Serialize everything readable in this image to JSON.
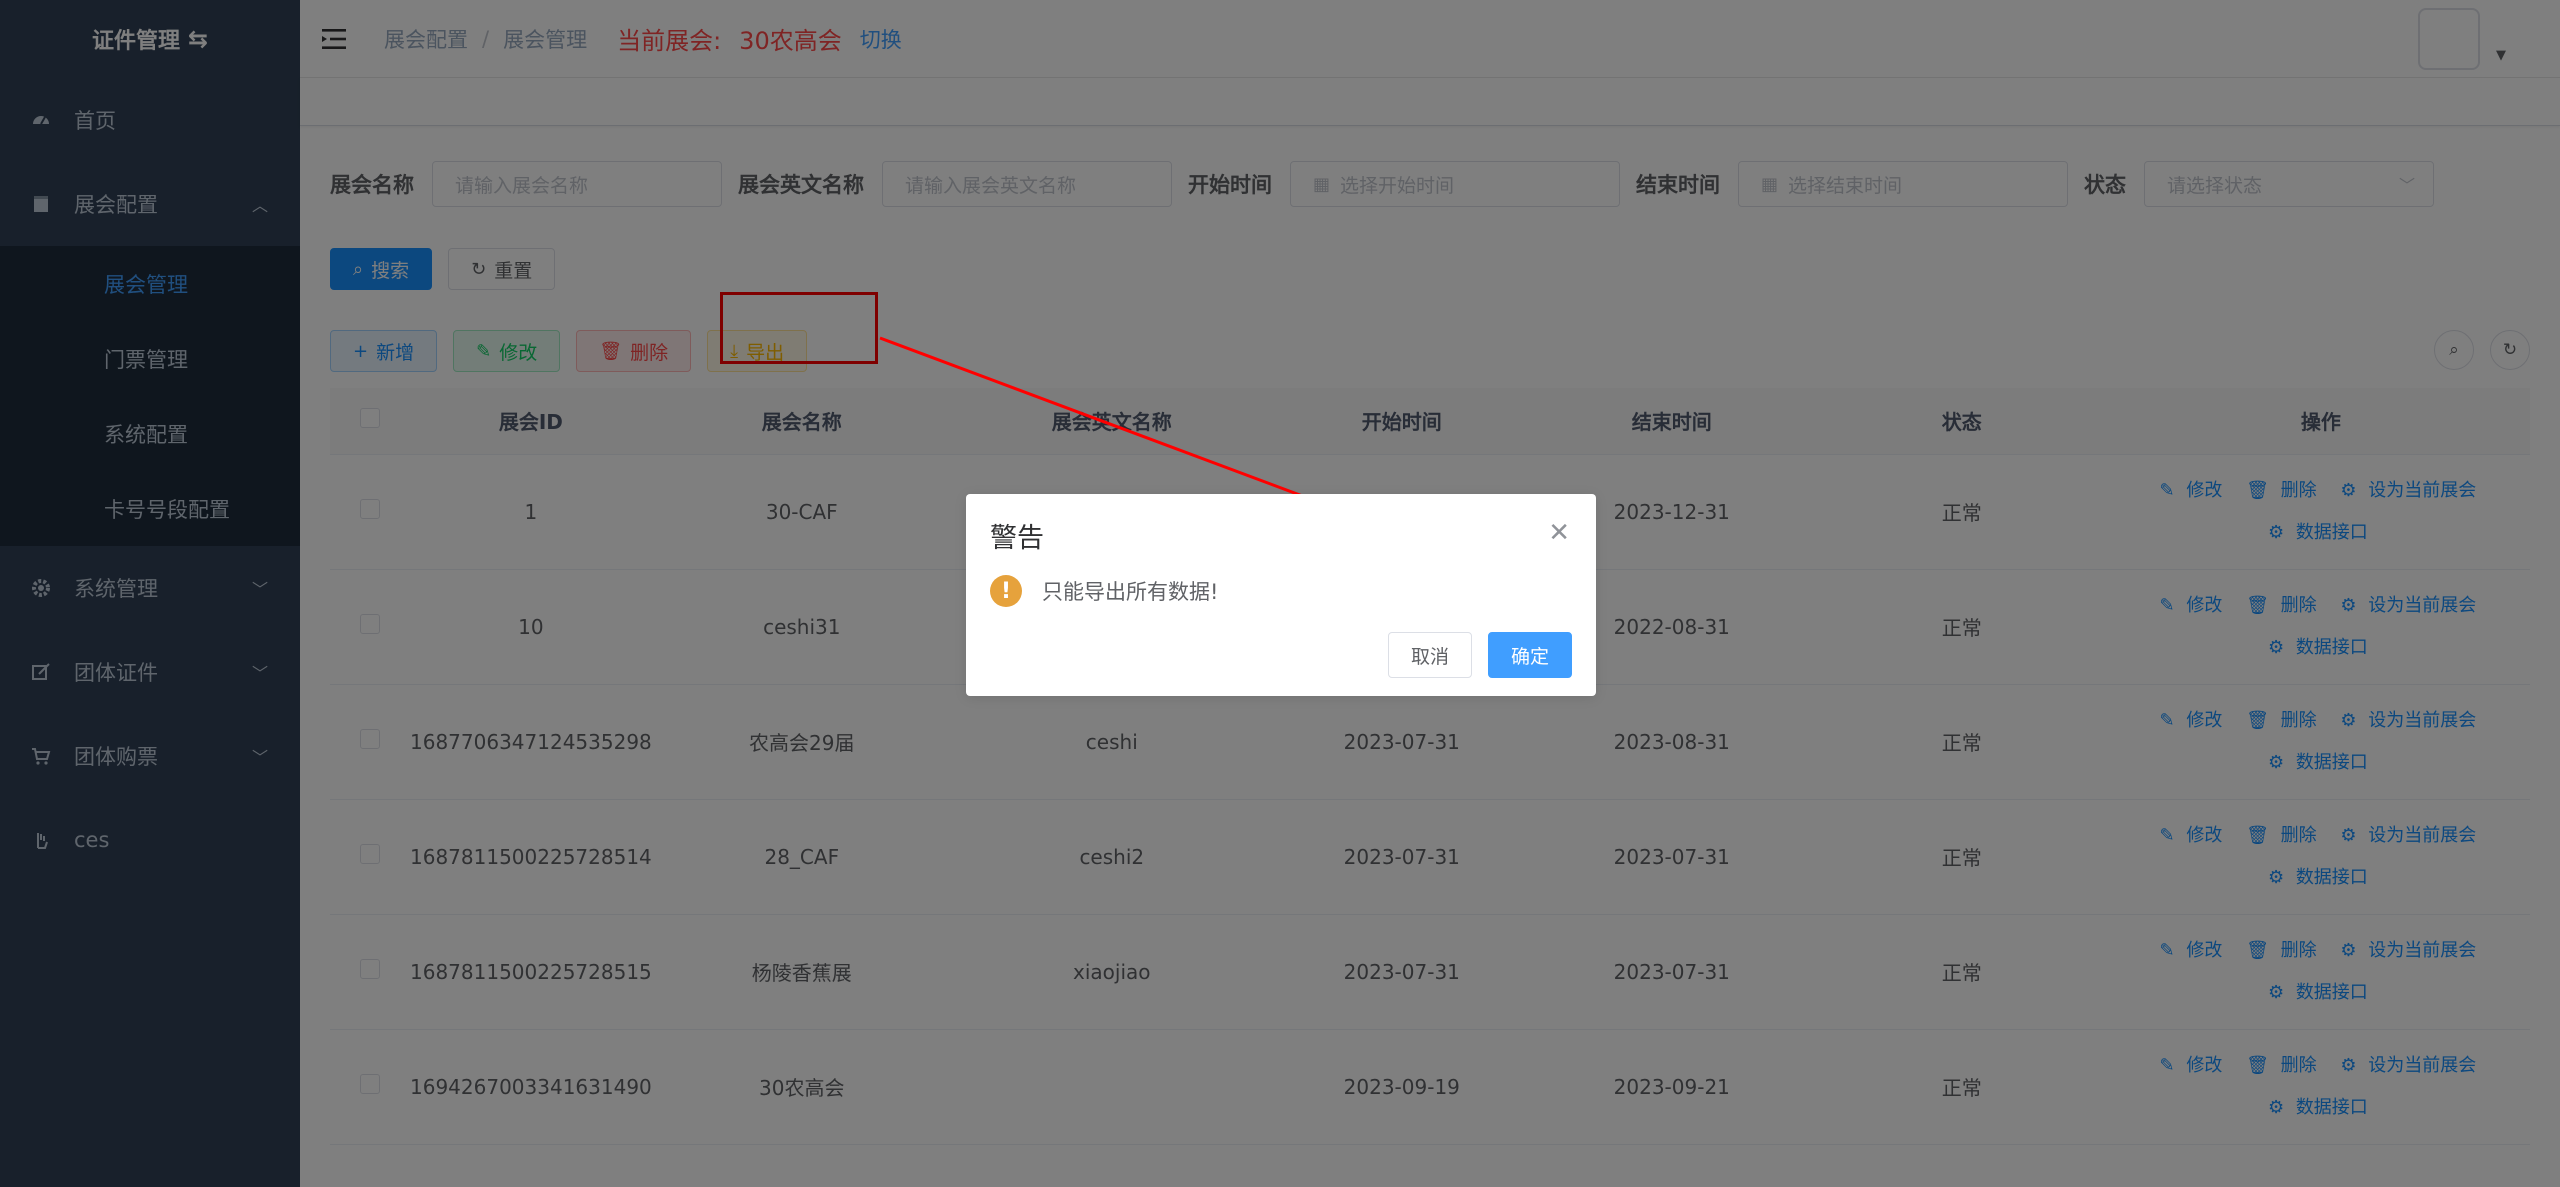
{
  "app": {
    "title": "证件管理"
  },
  "sidebar": {
    "items": [
      {
        "label": "首页",
        "icon": "dashboard-icon"
      },
      {
        "label": "展会配置",
        "icon": "document-icon",
        "expanded": true
      },
      {
        "label": "系统管理",
        "icon": "gear-icon"
      },
      {
        "label": "团体证件",
        "icon": "edit-icon"
      },
      {
        "label": "团体购票",
        "icon": "cart-icon"
      },
      {
        "label": "ces",
        "icon": "hand-icon"
      }
    ],
    "submenu": [
      {
        "label": "展会管理",
        "active": true
      },
      {
        "label": "门票管理"
      },
      {
        "label": "系统配置"
      },
      {
        "label": "卡号号段配置"
      }
    ]
  },
  "navbar": {
    "breadcrumb": [
      "展会配置",
      "展会管理"
    ],
    "current_label": "当前展会:",
    "current_value": "30农高会",
    "switch": "切换"
  },
  "search": {
    "name_label": "展会名称",
    "name_placeholder": "请输入展会名称",
    "en_label": "展会英文名称",
    "en_placeholder": "请输入展会英文名称",
    "start_label": "开始时间",
    "start_placeholder": "选择开始时间",
    "end_label": "结束时间",
    "end_placeholder": "选择结束时间",
    "status_label": "状态",
    "status_placeholder": "请选择状态",
    "search_btn": "搜索",
    "reset_btn": "重置"
  },
  "toolbar": {
    "add": "新增",
    "edit": "修改",
    "delete": "删除",
    "export": "导出"
  },
  "table": {
    "headers": [
      "展会ID",
      "展会名称",
      "展会英文名称",
      "开始时间",
      "结束时间",
      "状态",
      "操作"
    ],
    "rows": [
      {
        "id": "1",
        "name": "30-CAF",
        "en": "",
        "start": "",
        "end": "2023-12-31",
        "status": "正常"
      },
      {
        "id": "10",
        "name": "ceshi31",
        "en": "",
        "start": "",
        "end": "2022-08-31",
        "status": "正常"
      },
      {
        "id": "1687706347124535298",
        "name": "农高会29届",
        "en": "ceshi",
        "start": "2023-07-31",
        "end": "2023-08-31",
        "status": "正常"
      },
      {
        "id": "1687811500225728514",
        "name": "28_CAF",
        "en": "ceshi2",
        "start": "2023-07-31",
        "end": "2023-07-31",
        "status": "正常"
      },
      {
        "id": "1687811500225728515",
        "name": "杨陵香蕉展",
        "en": "xiaojiao",
        "start": "2023-07-31",
        "end": "2023-07-31",
        "status": "正常"
      },
      {
        "id": "1694267003341631490",
        "name": "30农高会",
        "en": "",
        "start": "2023-09-19",
        "end": "2023-09-21",
        "status": "正常"
      }
    ],
    "ops": {
      "edit": "修改",
      "delete": "删除",
      "set_current": "设为当前展会",
      "data_api": "数据接口"
    }
  },
  "dialog": {
    "title": "警告",
    "message": "只能导出所有数据!",
    "cancel": "取消",
    "confirm": "确定"
  },
  "colors": {
    "sidebar_bg": "#304156",
    "primary": "#1890ff",
    "danger": "#ff4949",
    "warning": "#e6a23c"
  }
}
